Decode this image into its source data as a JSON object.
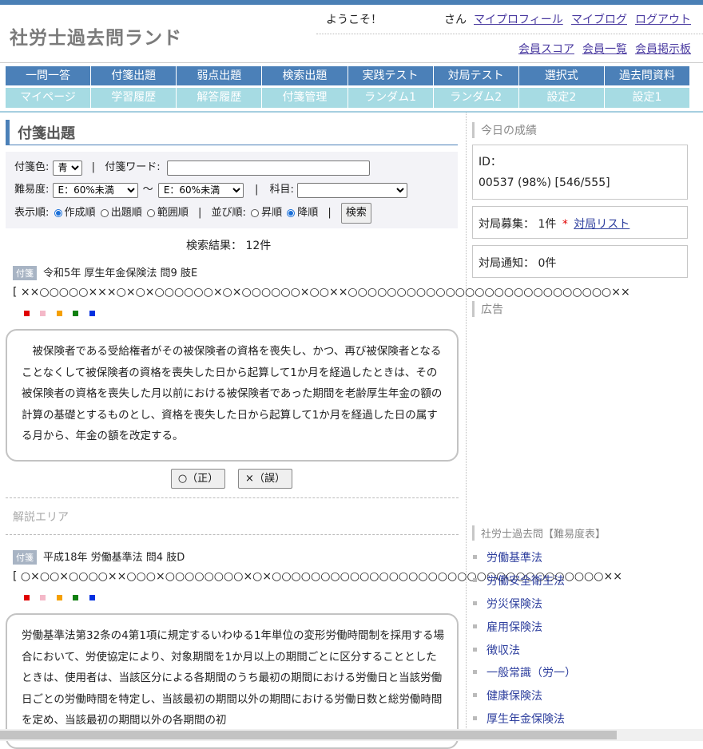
{
  "site": {
    "title": "社労士過去問ランド"
  },
  "header": {
    "welcome": "ようこそ！",
    "san": "さん",
    "links": [
      "マイプロフィール",
      "マイブログ",
      "ログアウト"
    ],
    "member_links": [
      "会員スコア",
      "会員一覧",
      "会員掲示板"
    ]
  },
  "nav": {
    "row1": [
      "一問一答",
      "付箋出題",
      "弱点出題",
      "検索出題",
      "実践テスト",
      "対局テスト",
      "選択式",
      "過去問資料"
    ],
    "row2": [
      "マイページ",
      "学習履歴",
      "解答履歴",
      "付箋管理",
      "ランダム1",
      "ランダム2",
      "設定2",
      "設定1"
    ]
  },
  "page": {
    "heading": "付箋出題"
  },
  "search": {
    "color_label": "付箋色:",
    "color_value": "青",
    "word_label": "付箋ワード:",
    "word_value": "",
    "difficulty_label": "難易度:",
    "difficulty_from": "E：60%未満",
    "difficulty_to": "E：60%未満",
    "range_sep": "～",
    "subject_label": "科目:",
    "subject_value": "",
    "order_label": "表示順:",
    "order_options": [
      "作成順",
      "出題順",
      "範囲順"
    ],
    "sort_label": "並び順:",
    "sort_options": [
      "昇順",
      "降順"
    ],
    "search_button": "検索",
    "sep": "|"
  },
  "results": {
    "count_text": "検索結果： 12件"
  },
  "questions": [
    {
      "tag": "付箋",
      "title": "令和5年 厚生年金保険法 問9 肢E",
      "marks": "[ ××○○○○○×××○×○×○○○○○○×○×○○○○○○×○○××○○○○○○○○○○○○○○○○○○○○○○○○○○○××",
      "text": "　被保険者である受給権者がその被保険者の資格を喪失し、かつ、再び被保険者となることなくして被保険者の資格を喪失した日から起算して1か月を経過したときは、その被保険者の資格を喪失した月以前における被保険者であった期間を老齢厚生年金の額の計算の基礎とするものとし、資格を喪失した日から起算して1か月を経過した日の属する月から、年金の額を改定する。",
      "btn_true": "○（正）",
      "btn_false": "×（誤）",
      "explanation_area": "解説エリア"
    },
    {
      "tag": "付箋",
      "title": "平成18年 労働基準法 問4 肢D",
      "marks": "[ ○×○○×○○○○××○○○×○○○○○○○○×○×○○○○○○○○○○○○○○○○○○○○○○○○○○○○○○○○○○××",
      "text": "労働基準法第32条の4第1項に規定するいわゆる1年単位の変形労働時間制を採用する場合において、労使協定により、対象期間を1か月以上の期間ごとに区分することとしたときは、使用者は、当該区分による各期間のうち最初の期間における労働日と当該労働日ごとの労働時間を特定し、当該最初の期間以外の期間における労働日数と総労働時間を定め、当該最初の期間以外の各期間の初"
    }
  ],
  "sticky_colors": [
    "#e00000",
    "#f4b8c8",
    "#f5a000",
    "#108010",
    "#0030e0"
  ],
  "sidebar": {
    "today_title": "今日の成績",
    "id_label": "ID：",
    "score": "00537 (98%) [546/555]",
    "match_recruit_label": "対局募集：",
    "match_recruit_count": "1件",
    "asterisk": "*",
    "match_list_link": "対局リスト",
    "match_notice_label": "対局通知：",
    "match_notice_count": "0件",
    "ad_title": "広告",
    "difficulty_title": "社労士過去問【難易度表】",
    "subjects": [
      "労働基準法",
      "労働安全衛生法",
      "労災保険法",
      "雇用保険法",
      "徴収法",
      "一般常識（労一）",
      "健康保険法",
      "厚生年金保険法"
    ]
  }
}
